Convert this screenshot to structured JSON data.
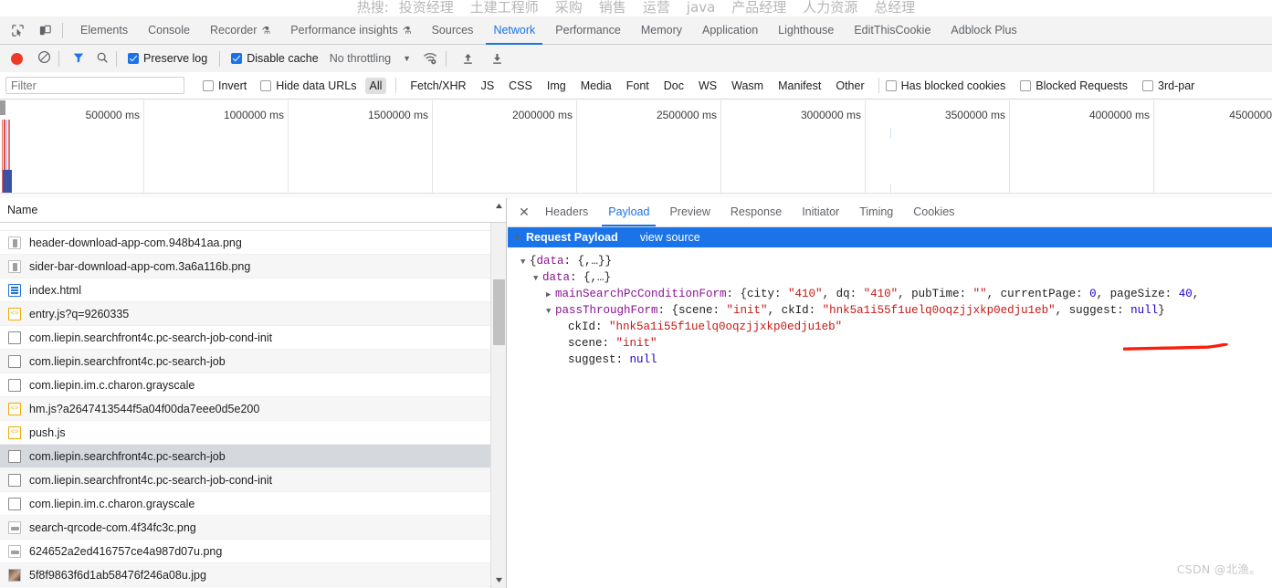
{
  "page_strip": {
    "hot_label": "热搜:",
    "hot_items": [
      "投资经理",
      "土建工程师",
      "采购",
      "销售",
      "运营",
      "java",
      "产品经理",
      "人力资源",
      "总经理"
    ]
  },
  "devtools": {
    "inspect_icon": "inspect-element-icon",
    "device_icon": "device-toolbar-icon",
    "tabs": [
      {
        "label": "Elements",
        "selected": false,
        "warn": false
      },
      {
        "label": "Console",
        "selected": false,
        "warn": false
      },
      {
        "label": "Recorder",
        "selected": false,
        "warn": true
      },
      {
        "label": "Performance insights",
        "selected": false,
        "warn": true
      },
      {
        "label": "Sources",
        "selected": false,
        "warn": false
      },
      {
        "label": "Network",
        "selected": true,
        "warn": false
      },
      {
        "label": "Performance",
        "selected": false,
        "warn": false
      },
      {
        "label": "Memory",
        "selected": false,
        "warn": false
      },
      {
        "label": "Application",
        "selected": false,
        "warn": false
      },
      {
        "label": "Lighthouse",
        "selected": false,
        "warn": false
      },
      {
        "label": "EditThisCookie",
        "selected": false,
        "warn": false
      },
      {
        "label": "Adblock Plus",
        "selected": false,
        "warn": false
      }
    ]
  },
  "network_toolbar": {
    "record_icon": "record-icon",
    "clear_icon": "clear-icon",
    "filter_icon": "filter-icon",
    "search_icon": "search-icon",
    "preserve_log": {
      "label": "Preserve log",
      "checked": true
    },
    "disable_cache": {
      "label": "Disable cache",
      "checked": true
    },
    "throttling": "No throttling",
    "throttle_caret": "chevron-down-icon",
    "wifi_icon": "network-conditions-icon",
    "import_icon": "import-har-icon",
    "export_icon": "export-har-icon"
  },
  "filter_bar": {
    "filter_placeholder": "Filter",
    "filter_value": "",
    "invert": {
      "label": "Invert",
      "checked": false
    },
    "hide_data_urls": {
      "label": "Hide data URLs",
      "checked": false
    },
    "resource_types": [
      "All",
      "Fetch/XHR",
      "JS",
      "CSS",
      "Img",
      "Media",
      "Font",
      "Doc",
      "WS",
      "Wasm",
      "Manifest",
      "Other"
    ],
    "selected_resource_type": "All",
    "has_blocked_cookies": {
      "label": "Has blocked cookies",
      "checked": false
    },
    "blocked_requests": {
      "label": "Blocked Requests",
      "checked": false
    },
    "third_party": {
      "label": "3rd-par",
      "checked": false
    }
  },
  "overview": {
    "ticks": [
      "500000 ms",
      "1000000 ms",
      "1500000 ms",
      "2000000 ms",
      "2500000 ms",
      "3000000 ms",
      "3500000 ms",
      "4000000 ms",
      "4500000"
    ]
  },
  "request_list": {
    "column_header": "Name",
    "rows": [
      {
        "name": "header-download-app-com.948b41aa.png",
        "icon": "image-icon",
        "selected": false
      },
      {
        "name": "sider-bar-download-app-com.3a6a116b.png",
        "icon": "image-icon",
        "selected": false
      },
      {
        "name": "index.html",
        "icon": "document-icon",
        "selected": false
      },
      {
        "name": "entry.js?q=9260335",
        "icon": "script-icon",
        "selected": false
      },
      {
        "name": "com.liepin.searchfront4c.pc-search-job-cond-init",
        "icon": "generic-icon",
        "selected": false
      },
      {
        "name": "com.liepin.searchfront4c.pc-search-job",
        "icon": "generic-icon",
        "selected": false
      },
      {
        "name": "com.liepin.im.c.charon.grayscale",
        "icon": "generic-icon",
        "selected": false
      },
      {
        "name": "hm.js?a2647413544f5a04f00da7eee0d5e200",
        "icon": "script-icon",
        "selected": false
      },
      {
        "name": "push.js",
        "icon": "script-icon",
        "selected": false
      },
      {
        "name": "com.liepin.searchfront4c.pc-search-job",
        "icon": "generic-icon",
        "selected": true
      },
      {
        "name": "com.liepin.searchfront4c.pc-search-job-cond-init",
        "icon": "generic-icon",
        "selected": false
      },
      {
        "name": "com.liepin.im.c.charon.grayscale",
        "icon": "generic-icon",
        "selected": false
      },
      {
        "name": "search-qrcode-com.4f34fc3c.png",
        "icon": "image-icon",
        "selected": false
      },
      {
        "name": "624652a2ed416757ce4a987d07u.png",
        "icon": "image-icon",
        "selected": false
      },
      {
        "name": "5f8f9863f6d1ab58476f246a08u.jpg",
        "icon": "photo-icon",
        "selected": false
      }
    ]
  },
  "detail_pane": {
    "close_icon": "close-icon",
    "tabs": [
      {
        "label": "Headers",
        "selected": false
      },
      {
        "label": "Payload",
        "selected": true
      },
      {
        "label": "Preview",
        "selected": false
      },
      {
        "label": "Response",
        "selected": false
      },
      {
        "label": "Initiator",
        "selected": false
      },
      {
        "label": "Timing",
        "selected": false
      },
      {
        "label": "Cookies",
        "selected": false
      }
    ],
    "section": {
      "title": "Request Payload",
      "view_source": "view source",
      "expanded": true
    },
    "payload_lines": [
      {
        "indent": 0,
        "tri": "▼",
        "text": "{data: {,…}}"
      },
      {
        "indent": 1,
        "tri": "▼",
        "text": "data: {,…}"
      },
      {
        "indent": 2,
        "tri": "▶",
        "text": "mainSearchPcConditionForm: {city: \"410\", dq: \"410\", pubTime: \"\", currentPage: 0, pageSize: 40,"
      },
      {
        "indent": 2,
        "tri": "▼",
        "text": "passThroughForm: {scene: \"init\", ckId: \"hnk5a1i55f1uelq0oqzjjxkp0edju1eb\", suggest: null}"
      },
      {
        "indent": 3,
        "tri": "",
        "text": "ckId: \"hnk5a1i55f1uelq0oqzjjxkp0edju1eb\""
      },
      {
        "indent": 3,
        "tri": "",
        "text": "scene: \"init\""
      },
      {
        "indent": 3,
        "tri": "",
        "text": "suggest: null"
      }
    ],
    "annotation": {
      "type": "red-underline",
      "color": "#fb1e0b"
    }
  },
  "watermark": "CSDN @北渔。",
  "colors": {
    "accent": "#1a73e8",
    "record": "#ec3b24",
    "annotation": "#fb1e0b",
    "key": "#881391",
    "string": "#c41a16",
    "number": "#1c00cf"
  }
}
